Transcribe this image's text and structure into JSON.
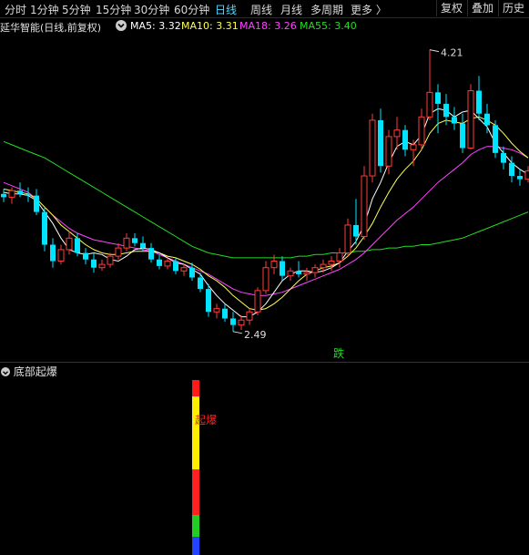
{
  "toolbar": {
    "timeframes": [
      "分时",
      "1分钟",
      "5分钟",
      "15分钟",
      "30分钟",
      "60分钟",
      "日线",
      "周线",
      "月线",
      "多周期",
      "更多 〉"
    ],
    "active_index": 6,
    "buttons": [
      "复权",
      "叠加",
      "历史"
    ]
  },
  "info": {
    "stock_title": "延华智能(日线,前复权)",
    "toggle_icon": "chevron-down-icon",
    "ma5": "MA5: 3.32",
    "ma10": "MA10: 3.31",
    "ma18": "MA18: 3.26",
    "ma55": "MA55: 3.40"
  },
  "chart_data": {
    "type": "candlestick",
    "high_label": "4.21",
    "low_label": "2.49",
    "event_label": "跌",
    "ylim": [
      2.4,
      4.28
    ],
    "colors": {
      "up": "#ff3c3c",
      "down": "#00e4ff",
      "ma5": "#ffffff",
      "ma10": "#ffff55",
      "ma18": "#ff44ff",
      "ma55": "#22dd22"
    },
    "candles": [
      [
        3.33,
        3.36,
        3.28,
        3.31
      ],
      [
        3.31,
        3.37,
        3.27,
        3.35
      ],
      [
        3.35,
        3.4,
        3.31,
        3.33
      ],
      [
        3.33,
        3.37,
        3.28,
        3.32
      ],
      [
        3.32,
        3.36,
        3.2,
        3.22
      ],
      [
        3.22,
        3.25,
        2.98,
        3.02
      ],
      [
        3.02,
        3.06,
        2.88,
        2.92
      ],
      [
        2.92,
        3.02,
        2.9,
        2.99
      ],
      [
        2.99,
        3.1,
        2.96,
        3.06
      ],
      [
        3.06,
        3.09,
        2.95,
        2.97
      ],
      [
        2.97,
        3.0,
        2.9,
        2.93
      ],
      [
        2.93,
        2.97,
        2.85,
        2.88
      ],
      [
        2.88,
        2.93,
        2.86,
        2.9
      ],
      [
        2.9,
        2.97,
        2.88,
        2.95
      ],
      [
        2.95,
        3.03,
        2.93,
        3.0
      ],
      [
        3.0,
        3.09,
        2.98,
        3.06
      ],
      [
        3.06,
        3.09,
        3.01,
        3.03
      ],
      [
        3.03,
        3.07,
        2.98,
        3.0
      ],
      [
        3.0,
        3.03,
        2.91,
        2.93
      ],
      [
        2.93,
        2.96,
        2.87,
        2.89
      ],
      [
        2.89,
        2.94,
        2.87,
        2.92
      ],
      [
        2.92,
        2.94,
        2.84,
        2.86
      ],
      [
        2.86,
        2.9,
        2.83,
        2.88
      ],
      [
        2.88,
        2.91,
        2.8,
        2.82
      ],
      [
        2.82,
        2.85,
        2.73,
        2.75
      ],
      [
        2.75,
        2.78,
        2.58,
        2.61
      ],
      [
        2.61,
        2.66,
        2.57,
        2.63
      ],
      [
        2.63,
        2.66,
        2.55,
        2.57
      ],
      [
        2.57,
        2.61,
        2.49,
        2.53
      ],
      [
        2.53,
        2.59,
        2.5,
        2.56
      ],
      [
        2.56,
        2.63,
        2.53,
        2.61
      ],
      [
        2.61,
        2.76,
        2.59,
        2.74
      ],
      [
        2.74,
        2.92,
        2.72,
        2.88
      ],
      [
        2.88,
        2.96,
        2.84,
        2.92
      ],
      [
        2.92,
        2.95,
        2.8,
        2.83
      ],
      [
        2.83,
        2.88,
        2.8,
        2.86
      ],
      [
        2.86,
        2.92,
        2.82,
        2.84
      ],
      [
        2.84,
        2.88,
        2.8,
        2.85
      ],
      [
        2.85,
        2.9,
        2.82,
        2.88
      ],
      [
        2.88,
        2.93,
        2.85,
        2.9
      ],
      [
        2.9,
        2.95,
        2.86,
        2.92
      ],
      [
        2.92,
        3.0,
        2.88,
        2.97
      ],
      [
        2.97,
        3.18,
        2.95,
        3.14
      ],
      [
        3.14,
        3.3,
        3.02,
        3.07
      ],
      [
        3.07,
        3.5,
        3.05,
        3.44
      ],
      [
        3.44,
        3.82,
        3.4,
        3.78
      ],
      [
        3.78,
        3.85,
        3.46,
        3.5
      ],
      [
        3.5,
        3.72,
        3.45,
        3.68
      ],
      [
        3.68,
        3.8,
        3.6,
        3.72
      ],
      [
        3.72,
        3.75,
        3.56,
        3.6
      ],
      [
        3.6,
        3.66,
        3.5,
        3.63
      ],
      [
        3.63,
        3.85,
        3.6,
        3.8
      ],
      [
        3.8,
        4.21,
        3.78,
        3.95
      ],
      [
        3.95,
        4.0,
        3.7,
        3.88
      ],
      [
        3.88,
        3.94,
        3.75,
        3.8
      ],
      [
        3.8,
        3.86,
        3.72,
        3.76
      ],
      [
        3.76,
        3.82,
        3.58,
        3.61
      ],
      [
        3.61,
        4.0,
        3.6,
        3.96
      ],
      [
        3.96,
        4.05,
        3.78,
        3.82
      ],
      [
        3.82,
        3.88,
        3.7,
        3.75
      ],
      [
        3.75,
        3.78,
        3.55,
        3.58
      ],
      [
        3.58,
        3.62,
        3.48,
        3.52
      ],
      [
        3.52,
        3.56,
        3.4,
        3.44
      ],
      [
        3.44,
        3.48,
        3.38,
        3.42
      ],
      [
        3.42,
        3.5,
        3.4,
        3.47
      ]
    ],
    "series": [
      {
        "name": "MA55",
        "values": [
          3.65,
          3.63,
          3.61,
          3.59,
          3.57,
          3.55,
          3.52,
          3.49,
          3.46,
          3.43,
          3.4,
          3.37,
          3.34,
          3.31,
          3.28,
          3.25,
          3.22,
          3.19,
          3.16,
          3.13,
          3.1,
          3.07,
          3.04,
          3.01,
          2.99,
          2.97,
          2.96,
          2.95,
          2.94,
          2.94,
          2.94,
          2.94,
          2.94,
          2.94,
          2.94,
          2.94,
          2.95,
          2.95,
          2.96,
          2.96,
          2.97,
          2.97,
          2.97,
          2.98,
          2.98,
          2.99,
          2.99,
          3.0,
          3.0,
          3.01,
          3.01,
          3.02,
          3.02,
          3.03,
          3.04,
          3.05,
          3.06,
          3.08,
          3.1,
          3.12,
          3.14,
          3.16,
          3.18,
          3.2,
          3.22
        ]
      },
      {
        "name": "MA18",
        "values": [
          3.4,
          3.38,
          3.36,
          3.34,
          3.3,
          3.25,
          3.2,
          3.16,
          3.12,
          3.09,
          3.07,
          3.05,
          3.04,
          3.03,
          3.02,
          3.01,
          3.0,
          2.99,
          2.98,
          2.96,
          2.94,
          2.92,
          2.9,
          2.88,
          2.86,
          2.84,
          2.81,
          2.78,
          2.75,
          2.73,
          2.72,
          2.71,
          2.71,
          2.72,
          2.73,
          2.75,
          2.77,
          2.79,
          2.81,
          2.83,
          2.85,
          2.87,
          2.9,
          2.93,
          2.97,
          3.02,
          3.07,
          3.12,
          3.17,
          3.21,
          3.25,
          3.3,
          3.35,
          3.4,
          3.44,
          3.48,
          3.52,
          3.57,
          3.6,
          3.62,
          3.62,
          3.61,
          3.6,
          3.58,
          3.55
        ]
      },
      {
        "name": "MA10",
        "values": [
          3.36,
          3.35,
          3.34,
          3.33,
          3.3,
          3.25,
          3.2,
          3.14,
          3.1,
          3.06,
          3.02,
          2.99,
          2.97,
          2.96,
          2.96,
          2.97,
          2.98,
          2.98,
          2.98,
          2.97,
          2.95,
          2.94,
          2.92,
          2.9,
          2.87,
          2.83,
          2.8,
          2.76,
          2.71,
          2.67,
          2.63,
          2.62,
          2.63,
          2.66,
          2.7,
          2.75,
          2.8,
          2.84,
          2.86,
          2.88,
          2.89,
          2.91,
          2.95,
          3.0,
          3.07,
          3.15,
          3.25,
          3.34,
          3.42,
          3.48,
          3.53,
          3.6,
          3.7,
          3.76,
          3.78,
          3.77,
          3.76,
          3.79,
          3.8,
          3.78,
          3.75,
          3.7,
          3.64,
          3.59,
          3.55
        ]
      },
      {
        "name": "MA5",
        "values": [
          3.34,
          3.33,
          3.33,
          3.32,
          3.29,
          3.22,
          3.15,
          3.06,
          2.99,
          2.97,
          2.96,
          2.97,
          2.96,
          2.93,
          2.92,
          2.95,
          2.99,
          3.0,
          2.99,
          2.97,
          2.94,
          2.91,
          2.9,
          2.87,
          2.84,
          2.77,
          2.71,
          2.66,
          2.62,
          2.58,
          2.58,
          2.61,
          2.66,
          2.73,
          2.8,
          2.84,
          2.86,
          2.86,
          2.85,
          2.86,
          2.88,
          2.91,
          2.98,
          3.04,
          3.14,
          3.3,
          3.4,
          3.52,
          3.62,
          3.65,
          3.63,
          3.69,
          3.82,
          3.85,
          3.84,
          3.8,
          3.83,
          3.84,
          3.79,
          3.74,
          3.64,
          3.58,
          3.52,
          3.48,
          3.45
        ]
      }
    ]
  },
  "sub": {
    "title": "底部起爆",
    "signal_label": "起爆"
  }
}
